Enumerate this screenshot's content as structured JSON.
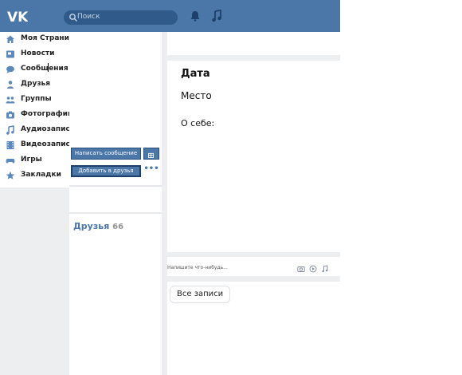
{
  "header": {
    "search_placeholder": "Поиск"
  },
  "sidebar": {
    "items": [
      {
        "label": "Моя Страница",
        "icon": "home-icon"
      },
      {
        "label": "Новости",
        "icon": "news-icon"
      },
      {
        "label": "Сообщения",
        "icon": "messages-icon"
      },
      {
        "label": "Друзья",
        "icon": "friends-icon"
      },
      {
        "label": "Группы",
        "icon": "groups-icon"
      },
      {
        "label": "Фотографии",
        "icon": "camera-icon"
      },
      {
        "label": "Аудиозаписи",
        "icon": "music-icon"
      },
      {
        "label": "Видеозаписи",
        "icon": "video-icon"
      },
      {
        "label": "Игры",
        "icon": "gamepad-icon"
      },
      {
        "label": "Закладки",
        "icon": "star-icon"
      }
    ]
  },
  "profile": {
    "send_message_label": "Написать сообщение",
    "add_friend_label": "Добавить в друзья",
    "more_label": "•••",
    "friends_label": "Друзья",
    "friends_count": "66"
  },
  "info": {
    "date_label": "Дата",
    "place_label": "Место",
    "about_label": "О себе:"
  },
  "wall": {
    "post_placeholder": "Напишите что-нибудь...",
    "all_posts_label": "Все записи"
  },
  "colors": {
    "brand": "#4a76a8",
    "background": "#edeef0"
  }
}
